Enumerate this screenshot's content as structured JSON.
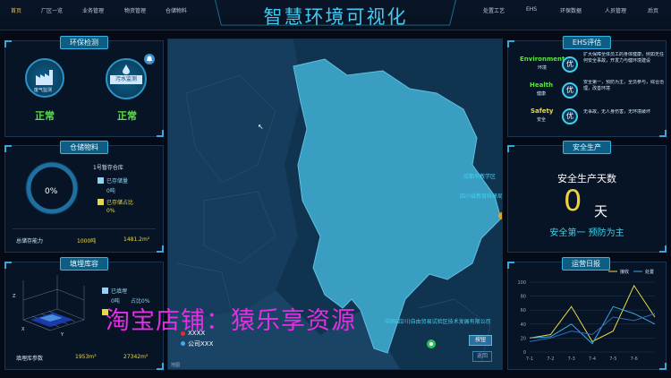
{
  "header": {
    "title": "智慧环境可视化",
    "nav_left": [
      "首页",
      "厂区一览",
      "业务管理",
      "物资管理",
      "仓储物料"
    ],
    "nav_right": [
      "处置工艺",
      "EHS",
      "环保数据",
      "人员管理",
      "后页"
    ]
  },
  "env": {
    "title": "环保检测",
    "items": [
      {
        "label": "废气监测",
        "status": "正常",
        "icon": "factory-icon"
      },
      {
        "label": "污水监测",
        "status": "正常",
        "icon": "water-drop-icon"
      }
    ]
  },
  "storage": {
    "title": "仓储物料",
    "percent": "0%",
    "warehouse": "1号暂存仓库",
    "stored_label": "已存储量",
    "stored_value": "0吨",
    "ratio_label": "已存储占比",
    "ratio_value": "0%",
    "capacity_label": "总储存能力",
    "capacity_value": "1000吨",
    "area_value": "1481.2m²"
  },
  "landfill": {
    "title": "填埋库容",
    "used_label": "已填埋",
    "used_value": "0吨",
    "used_ratio": "占比0%",
    "params_label": "填埋库参数",
    "volume1": "1953m³",
    "volume2": "27342m³",
    "axis": [
      "Z",
      "Y",
      "X"
    ],
    "ticks": [
      "10",
      "8",
      "6",
      "4",
      "2",
      "0"
    ]
  },
  "map": {
    "labels": [
      "成都市教学区",
      "四川省教育科研局",
      "XXXX",
      "公司XXX",
      "中国(四川)自由贸易试验区技术发展有限公司"
    ],
    "btn1": "按钮",
    "btn2": "返回",
    "logo": "地图",
    "watermark": "淘宝店铺：猿乐享资源"
  },
  "ehs": {
    "title": "EHS评估",
    "rows": [
      {
        "en": "Environment",
        "cn": "环境",
        "grade": "优",
        "desc": "扩大保障全体员工的身体健康，例如无任何安全事故，开发力与健环境建设"
      },
      {
        "en": "Health",
        "cn": "健康",
        "grade": "优",
        "desc": "安全第一，预防为主，全员参与，综合治理，改善环境"
      },
      {
        "en": "Safety",
        "cn": "安全",
        "grade": "优",
        "desc": "无事故，无人身伤害，无环境破坏"
      }
    ]
  },
  "safety": {
    "title": "安全生产",
    "days_label": "安全生产天数",
    "days": "0",
    "unit": "天",
    "slogan": "安全第一 预防为主"
  },
  "ops": {
    "title": "运营日报",
    "legend": [
      "接收",
      "处置"
    ],
    "yticks": [
      "100",
      "80",
      "60",
      "40",
      "20",
      "0"
    ],
    "xticks": [
      "7-1",
      "7-2",
      "7-3",
      "7-4",
      "7-5",
      "7-6"
    ]
  },
  "chart_data": {
    "type": "line",
    "x": [
      "7-1",
      "7-2",
      "7-3",
      "7-4",
      "7-5",
      "7-6",
      "7-7"
    ],
    "ylim": [
      0,
      100
    ],
    "series": [
      {
        "name": "接收",
        "values": [
          20,
          25,
          65,
          15,
          30,
          95,
          50
        ],
        "color": "#e8d84a"
      },
      {
        "name": "处置",
        "values": [
          20,
          22,
          40,
          12,
          65,
          55,
          40
        ],
        "color": "#3aa8e0"
      },
      {
        "values": [
          15,
          20,
          30,
          25,
          50,
          45,
          55
        ],
        "color": "#2a6cc0"
      }
    ]
  }
}
